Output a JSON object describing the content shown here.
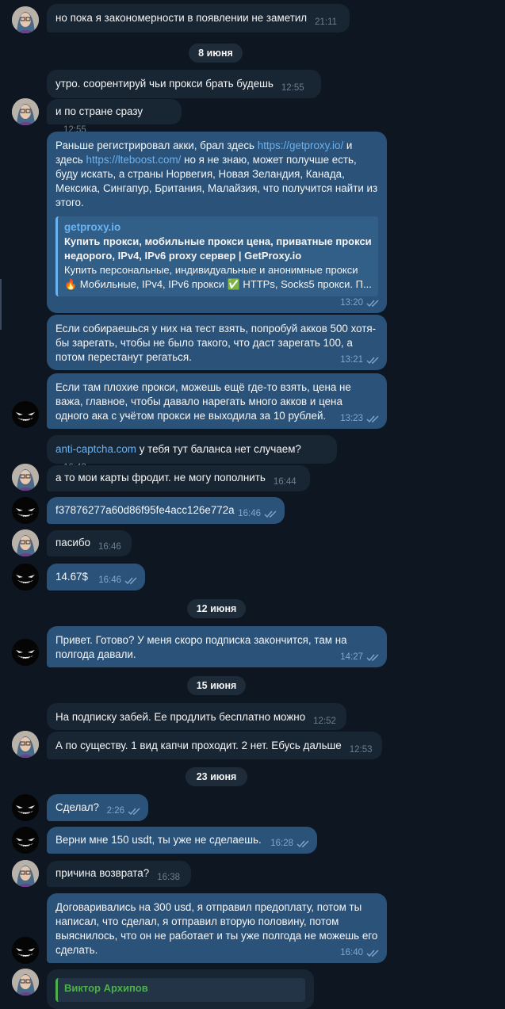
{
  "dates": [
    "8 июня",
    "12 июня",
    "15 июня",
    "23 июня"
  ],
  "messages": [
    {
      "text": "но пока я закономерности в появлении не заметил",
      "time": "21:11"
    },
    {
      "text": "утро. соорентируй чьи прокси брать будешь",
      "time": "12:55"
    },
    {
      "text": "и по стране сразу",
      "time": "12:55"
    },
    {
      "before_link1": "Раньше регистрировал акки, брал здесь ",
      "link1": "https://getproxy.io/",
      "between": " и здесь ",
      "link2": "https://lteboost.com/",
      "after": " но я не знаю, может получше есть, буду искать, а страны Норвегия, Новая Зеландия, Канада, Мексика, Сингапур, Британия, Малайзия, что получится найти из этого.",
      "preview_site": "getproxy.io",
      "preview_title": "Купить прокси, мобильные прокси цена, приватные прокси недорого, IPv4, IPv6 proxy сервер  | GetProxy.io",
      "preview_desc": "Купить персональные, индивидуальные и анонимные прокси 🔥 Мобильные, IPv4, IPv6 прокси ✅ HTTPs, Socks5 прокси. П...",
      "time": "13:20"
    },
    {
      "text": "Если собираешься у них на тест взять, попробуй акков 500 хотя-бы зарегать, чтобы не было такого, что даст зарегать 100, а потом перестанут регаться.",
      "time": "13:21"
    },
    {
      "text": "Если там плохие прокси, можешь ещё где-то взять, цена не важа, главное, чтобы давало нарегать много акков и цена одного ака с учётом прокси не выходила за 10 рублей.",
      "time": "13:23"
    },
    {
      "link": "anti-captcha.com",
      "text": " у тебя тут баланса нет случаем?",
      "time": "16:43"
    },
    {
      "text": "а то мои карты фродит. не могу пополнить",
      "time": "16:44"
    },
    {
      "text": "f37876277a60d86f95fe4acc126e772a",
      "time": "16:46"
    },
    {
      "text": "пасибо",
      "time": "16:46"
    },
    {
      "text": "14.67$",
      "time": "16:46"
    },
    {
      "text": "Привет. Готово? У меня скоро подписка закончится, там на полгода давали.",
      "time": "14:27"
    },
    {
      "text": "На подписку забей. Ее продлить бесплатно можно",
      "time": "12:52"
    },
    {
      "text": "А по существу. 1 вид капчи проходит. 2 нет. Ебусь дальше",
      "time": "12:53"
    },
    {
      "text": "Сделал?",
      "time": "2:26"
    },
    {
      "text": "Верни мне 150 usdt, ты уже не сделаешь.",
      "time": "16:28"
    },
    {
      "text": "причина возврата?",
      "time": "16:38"
    },
    {
      "text": "Договаривались на 300 usd, я отправил предоплату, потом ты написал, что сделал, я отправил вторую половину, потом выяснилось, что он не работает и ты уже полгода не можешь его сделать.",
      "time": "16:40"
    },
    {
      "reply_name": "Виктор Архипов"
    }
  ],
  "colors": {
    "background": "#0e1621",
    "incoming": "#182533",
    "outgoing": "#2b5278",
    "link": "#6ab3f3",
    "reply_accent": "#4fae4e"
  },
  "icons": {
    "read_receipt": "double-check-icon",
    "user_avatar_a": "cartoon-girl-avatar",
    "user_avatar_b": "dark-grin-avatar",
    "fire": "🔥",
    "check": "✅"
  }
}
